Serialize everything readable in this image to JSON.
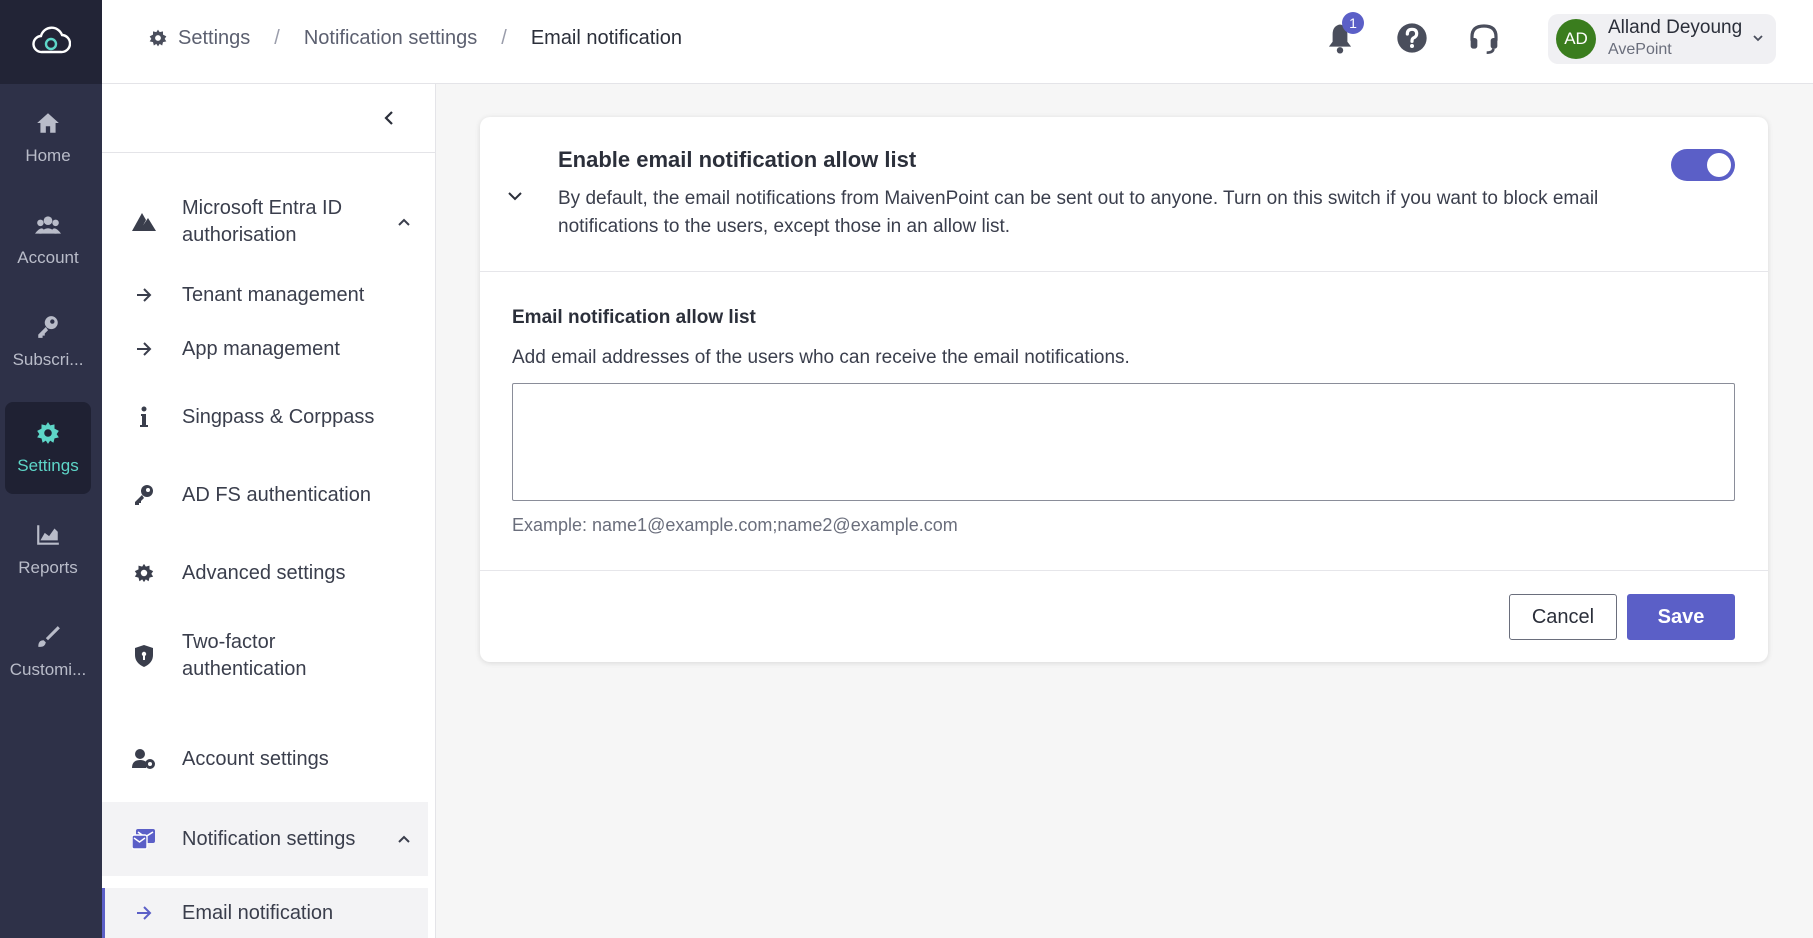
{
  "rail": {
    "items": [
      {
        "label": "Home",
        "icon": "home-icon"
      },
      {
        "label": "Account",
        "icon": "users-icon"
      },
      {
        "label": "Subscri...",
        "icon": "key-icon"
      },
      {
        "label": "Settings",
        "icon": "gear-icon",
        "active": true
      },
      {
        "label": "Reports",
        "icon": "chart-icon"
      },
      {
        "label": "Customi...",
        "icon": "brush-icon"
      }
    ]
  },
  "breadcrumb": {
    "items": [
      "Settings",
      "Notification settings",
      "Email notification"
    ]
  },
  "header": {
    "notification_count": "1",
    "user": {
      "initials": "AD",
      "name": "Alland Deyoung",
      "org": "AvePoint"
    }
  },
  "nav": {
    "items": [
      {
        "label": "Microsoft Entra ID authorisation",
        "icon": "entra-icon",
        "expanded": true
      },
      {
        "label": "Tenant management",
        "icon": "arrow-right-icon"
      },
      {
        "label": "App management",
        "icon": "arrow-right-icon"
      },
      {
        "label": "Singpass & Corppass",
        "icon": "info-icon"
      },
      {
        "label": "AD FS authentication",
        "icon": "key-icon"
      },
      {
        "label": "Advanced settings",
        "icon": "gear-icon"
      },
      {
        "label": "Two-factor authentication",
        "icon": "shield-icon"
      },
      {
        "label": "Account settings",
        "icon": "user-gear-icon"
      },
      {
        "label": "Notification settings",
        "icon": "notification-icon",
        "expanded": true
      },
      {
        "label": "Email notification",
        "icon": "arrow-right-icon",
        "selected": true
      }
    ]
  },
  "card": {
    "title": "Enable email notification allow list",
    "description": "By default, the email notifications from MaivenPoint can be sent out to anyone. Turn on this switch if you want to block email notifications to the users, except those in an allow list.",
    "toggle_on": true,
    "section_title": "Email notification allow list",
    "section_description": "Add email addresses of the users who can receive the email notifications.",
    "allow_list_value": "",
    "example": "Example: name1@example.com;name2@example.com",
    "cancel_label": "Cancel",
    "save_label": "Save"
  },
  "colors": {
    "accent": "#5b5fc7",
    "rail_bg": "#2e3148",
    "rail_active_text": "#5ed6c8",
    "avatar": "#3a7d1e"
  }
}
